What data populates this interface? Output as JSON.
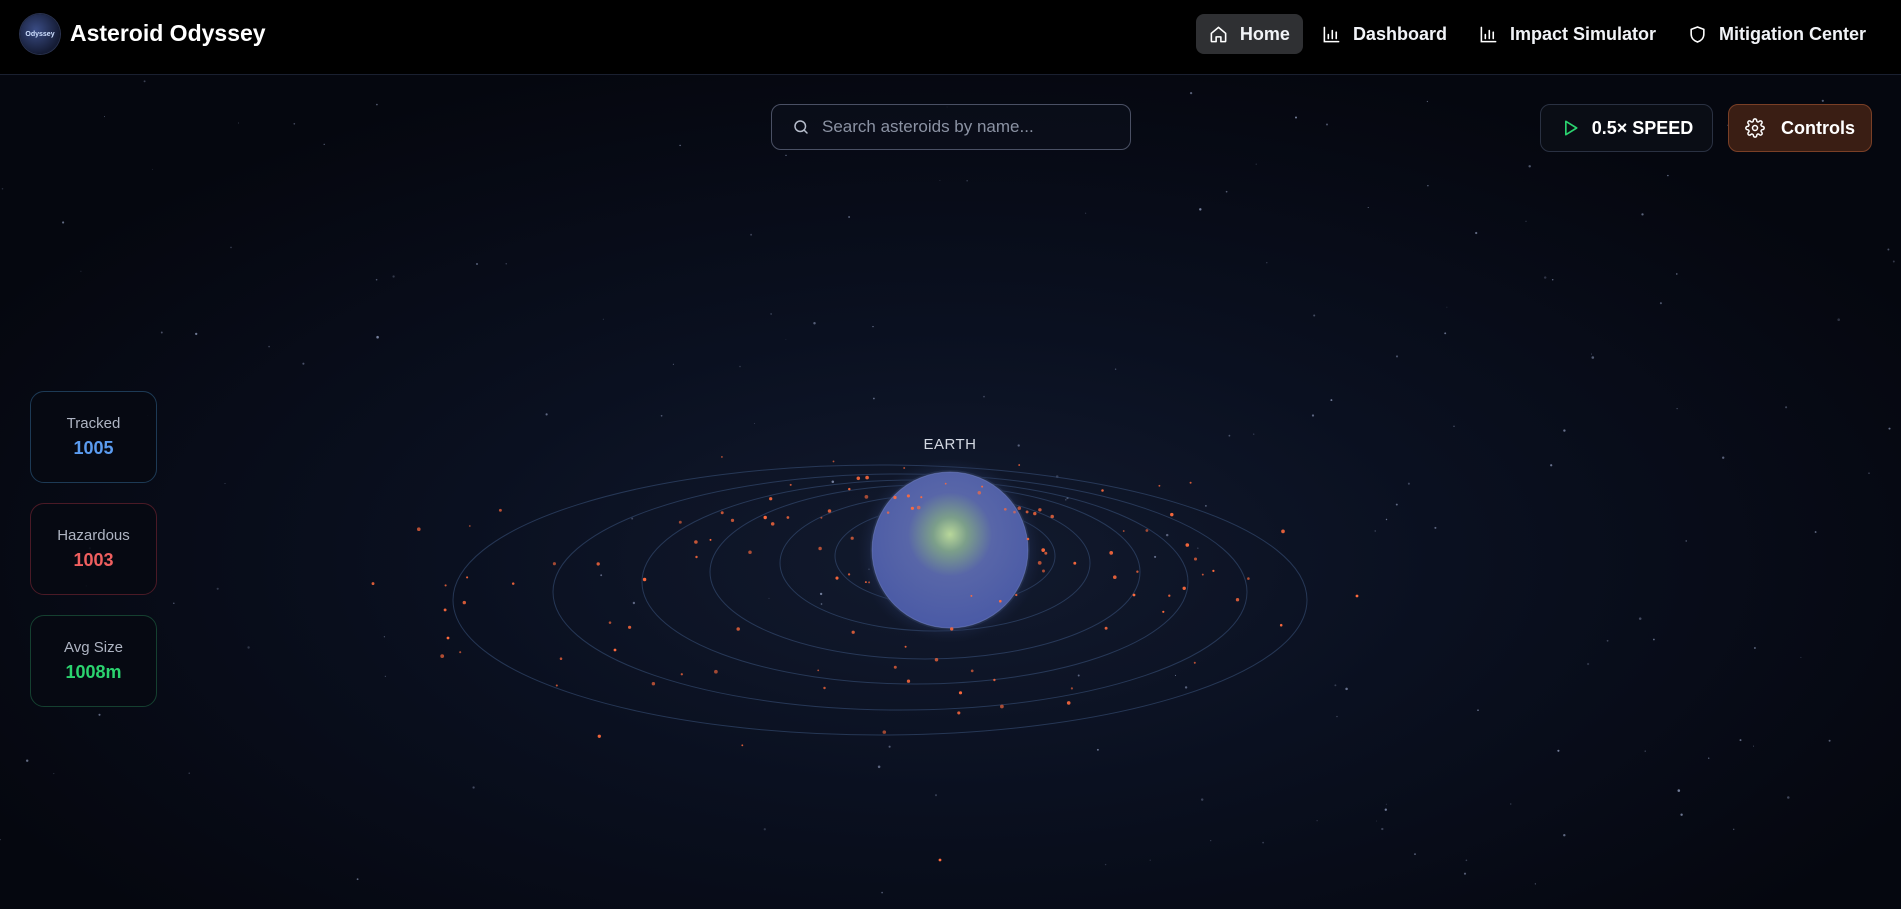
{
  "app": {
    "title": "Asteroid Odyssey",
    "logo_text": "Odyssey"
  },
  "nav": {
    "items": [
      {
        "label": "Home",
        "icon": "home-icon",
        "active": true
      },
      {
        "label": "Dashboard",
        "icon": "bar-chart-icon",
        "active": false
      },
      {
        "label": "Impact Simulator",
        "icon": "bar-chart-icon",
        "active": false
      },
      {
        "label": "Mitigation Center",
        "icon": "shield-icon",
        "active": false
      }
    ]
  },
  "search": {
    "placeholder": "Search asteroids by name...",
    "value": ""
  },
  "toolbar": {
    "speed_label": "0.5× SPEED",
    "speed_icon": "play-icon",
    "controls_label": "Controls",
    "controls_icon": "gear-icon"
  },
  "stats": {
    "tracked": {
      "label": "Tracked",
      "value": "1005"
    },
    "hazardous": {
      "label": "Hazardous",
      "value": "1003"
    },
    "avg_size": {
      "label": "Avg Size",
      "value": "1008m"
    }
  },
  "scene": {
    "earth_label": "EARTH"
  },
  "colors": {
    "background": "#05070f",
    "tracked": "#5b9cf0",
    "hazardous": "#ef5f5f",
    "avg_size": "#2bd36f",
    "asteroid": "#ff6a3d",
    "controls_accent": "#3a1e14"
  }
}
